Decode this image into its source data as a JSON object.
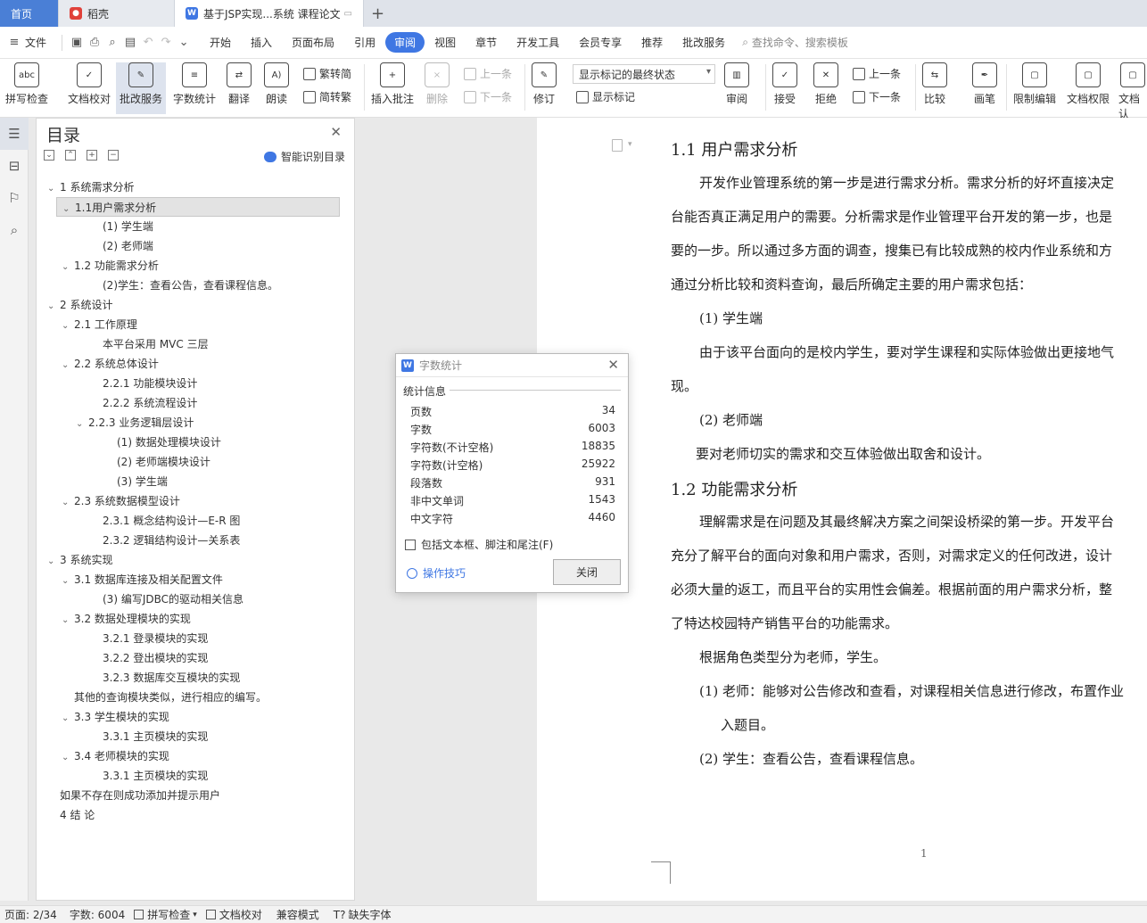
{
  "tabs": [
    {
      "label": "首页"
    },
    {
      "label": "稻壳"
    },
    {
      "label": "基于JSP实现...系统 课程论文"
    }
  ],
  "menu": {
    "file": "文件",
    "items": [
      "开始",
      "插入",
      "页面布局",
      "引用",
      "审阅",
      "视图",
      "章节",
      "开发工具",
      "会员专享",
      "推荐",
      "批改服务"
    ],
    "active": "审阅",
    "search_placeholder": "查找命令、搜索模板"
  },
  "ribbon": {
    "spellcheck": "拼写检查",
    "proofread": "文档校对",
    "review_service": "批改服务",
    "word_count": "字数统计",
    "translate": "翻译",
    "read_aloud": "朗读",
    "to_traditional": "繁转简",
    "to_simplified": "简转繁",
    "insert_comment": "插入批注",
    "delete": "删除",
    "prev_comment": "上一条",
    "next_comment": "下一条",
    "track": "修订",
    "display_mode": "显示标记的最终状态",
    "show_markup": "显示标记",
    "review": "审阅",
    "accept": "接受",
    "reject": "拒绝",
    "prev_change": "上一条",
    "next_change": "下一条",
    "compare": "比较",
    "draw": "画笔",
    "restrict": "限制编辑",
    "permission": "文档权限",
    "more": "文档认"
  },
  "toc": {
    "title": "目录",
    "smart": "智能识别目录",
    "items": [
      {
        "text": "1  系统需求分析",
        "level": 0,
        "caret": true
      },
      {
        "text": "1.1用户需求分析",
        "level": 1,
        "caret": true,
        "selected": true
      },
      {
        "text": "(1)  学生端",
        "level": 2,
        "caret": false
      },
      {
        "text": "(2)  老师端",
        "level": 2,
        "caret": false
      },
      {
        "text": "1.2  功能需求分析",
        "level": 1,
        "caret": true
      },
      {
        "text": "(2)学生：查看公告，查看课程信息。",
        "level": 2,
        "caret": false
      },
      {
        "text": "2  系统设计",
        "level": 0,
        "caret": true
      },
      {
        "text": "2.1 工作原理",
        "level": 1,
        "caret": true
      },
      {
        "text": "本平台采用 MVC 三层",
        "level": 2,
        "caret": false
      },
      {
        "text": "2.2  系统总体设计",
        "level": 1,
        "caret": true
      },
      {
        "text": "2.2.1  功能模块设计",
        "level": 2,
        "caret": false
      },
      {
        "text": "2.2.2  系统流程设计",
        "level": 2,
        "caret": false
      },
      {
        "text": "2.2.3  业务逻辑层设计",
        "level": 2,
        "caret": true
      },
      {
        "text": "(1)  数据处理模块设计",
        "level": 3,
        "caret": false
      },
      {
        "text": "(2)  老师端模块设计",
        "level": 3,
        "caret": false
      },
      {
        "text": "(3)  学生端",
        "level": 3,
        "caret": false
      },
      {
        "text": "2.3  系统数据模型设计",
        "level": 1,
        "caret": true
      },
      {
        "text": "2.3.1  概念结构设计—E-R 图",
        "level": 2,
        "caret": false
      },
      {
        "text": "2.3.2  逻辑结构设计—关系表",
        "level": 2,
        "caret": false
      },
      {
        "text": "3  系统实现",
        "level": 0,
        "caret": true
      },
      {
        "text": "3.1  数据库连接及相关配置文件",
        "level": 1,
        "caret": true
      },
      {
        "text": "(3)  编写JDBC的驱动相关信息",
        "level": 2,
        "caret": false
      },
      {
        "text": "3.2  数据处理模块的实现",
        "level": 1,
        "caret": true
      },
      {
        "text": "3.2.1 登录模块的实现",
        "level": 2,
        "caret": false
      },
      {
        "text": "3.2.2 登出模块的实现",
        "level": 2,
        "caret": false
      },
      {
        "text": "3.2.3 数据库交互模块的实现",
        "level": 2,
        "caret": false
      },
      {
        "text": "其他的查询模块类似，进行相应的编写。",
        "level": 1,
        "caret": false
      },
      {
        "text": "3.3  学生模块的实现",
        "level": 1,
        "caret": true
      },
      {
        "text": "3.3.1 主页模块的实现",
        "level": 2,
        "caret": false
      },
      {
        "text": "3.4  老师模块的实现",
        "level": 1,
        "caret": true
      },
      {
        "text": "3.3.1 主页模块的实现",
        "level": 2,
        "caret": false
      },
      {
        "text": "如果不存在则成功添加并提示用户",
        "level": 0,
        "caret": false
      },
      {
        "text": "4  结  论",
        "level": 0,
        "caret": false
      }
    ]
  },
  "document": {
    "h1": "1.1 用户需求分析",
    "p1": [
      "开发作业管理系统的第一步是进行需求分析。需求分析的好坏直接决定",
      "台能否真正满足用户的需要。分析需求是作业管理平台开发的第一步，也是",
      "要的一步。所以通过多方面的调查，搜集已有比较成熟的校内作业系统和方",
      "通过分析比较和资料查询，最后所确定主要的用户需求包括："
    ],
    "s1": "(1)  学生端",
    "p2": [
      "由于该平台面向的是校内学生，要对学生课程和实际体验做出更接地气",
      "现。"
    ],
    "s2": "(2)  老师端",
    "p3": "要对老师切实的需求和交互体验做出取舍和设计。",
    "h2": "1.2  功能需求分析",
    "p4": [
      "理解需求是在问题及其最终解决方案之间架设桥梁的第一步。开发平台",
      "充分了解平台的面向对象和用户需求，否则，对需求定义的任何改进，设计",
      "必须大量的返工，而且平台的实用性会偏差。根据前面的用户需求分析，整",
      "了特达校园特产销售平台的功能需求。"
    ],
    "p5": "根据角色类型分为老师，学生。",
    "l1a": "(1) 老师：能够对公告修改和查看，对课程相关信息进行修改，布置作业",
    "l1b": "入题目。",
    "l2": "(2) 学生：查看公告，查看课程信息。",
    "page_number": "1"
  },
  "dialog": {
    "title": "字数统计",
    "group": "统计信息",
    "stats": [
      {
        "label": "页数",
        "value": "34"
      },
      {
        "label": "字数",
        "value": "6003"
      },
      {
        "label": "字符数(不计空格)",
        "value": "18835"
      },
      {
        "label": "字符数(计空格)",
        "value": "25922"
      },
      {
        "label": "段落数",
        "value": "931"
      },
      {
        "label": "非中文单词",
        "value": "1543"
      },
      {
        "label": "中文字符",
        "value": "4460"
      }
    ],
    "include": "包括文本框、脚注和尾注(F)",
    "tips": "操作技巧",
    "close": "关闭"
  },
  "status": {
    "page": "页面: 2/34",
    "words": "字数: 6004",
    "spell": "拼写检查",
    "proof": "文档校对",
    "compat": "兼容模式",
    "missing_font": "缺失字体"
  },
  "colors": {
    "accent": "#3f77e3",
    "home_tab": "#4a7fd6"
  }
}
